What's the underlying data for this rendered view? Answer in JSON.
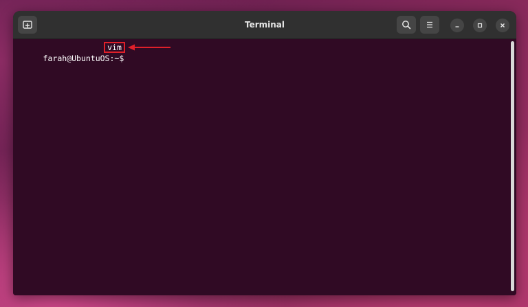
{
  "window": {
    "title": "Terminal"
  },
  "titlebar": {
    "new_tab_icon": "new-tab-icon",
    "search_icon": "search-icon",
    "menu_icon": "hamburger-menu-icon",
    "minimize_icon": "minimize-icon",
    "maximize_icon": "maximize-icon",
    "close_icon": "close-icon"
  },
  "terminal": {
    "prompt": "farah@UbuntuOS:~$ ",
    "command": "vim",
    "highlight_color": "#e0202a",
    "background_color": "#300a24"
  }
}
